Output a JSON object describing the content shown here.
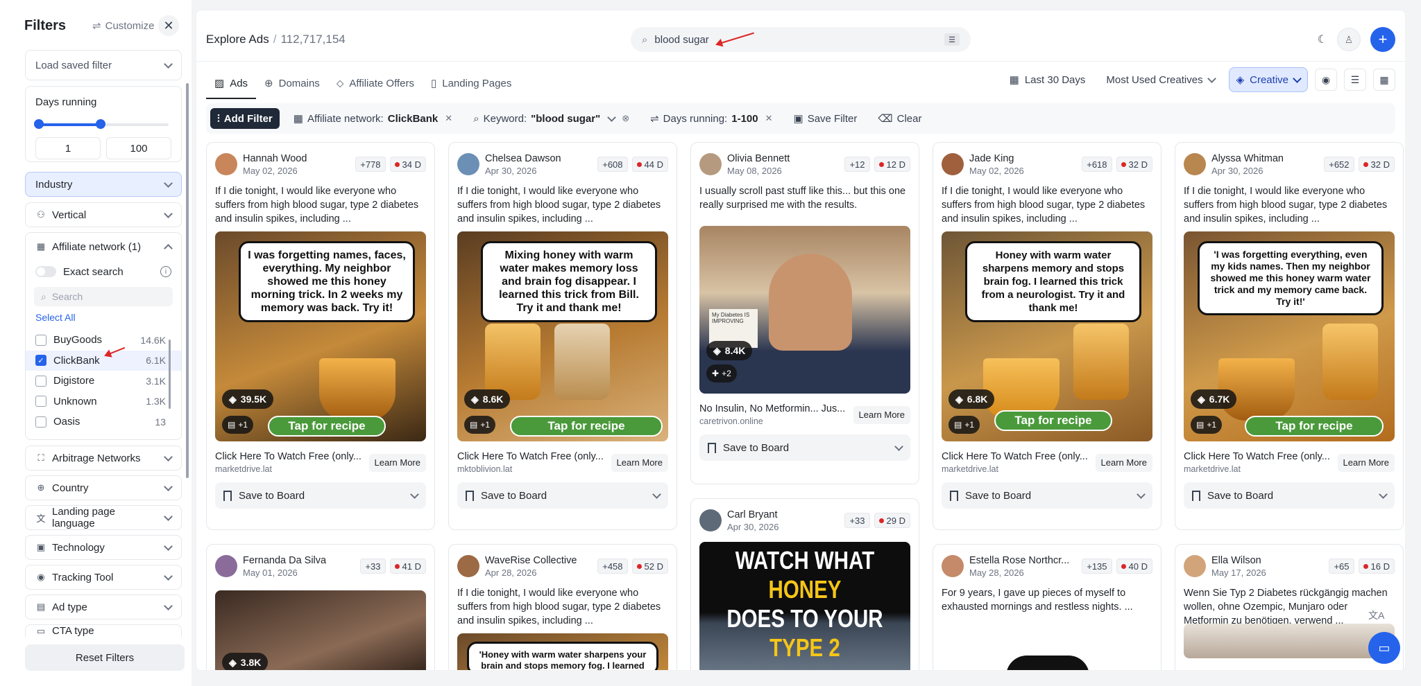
{
  "sidebar": {
    "title": "Filters",
    "customize": "Customize",
    "saved_filter_placeholder": "Load saved filter",
    "days_running": {
      "label": "Days running",
      "min": "1",
      "max": "100"
    },
    "sections": [
      "Industry",
      "Vertical"
    ],
    "affiliate": {
      "label": "Affiliate network (1)",
      "exact_search": "Exact search",
      "search_placeholder": "Search",
      "select_all": "Select All",
      "options": [
        {
          "name": "BuyGoods",
          "count": "14.6K",
          "checked": false
        },
        {
          "name": "ClickBank",
          "count": "6.1K",
          "checked": true
        },
        {
          "name": "Digistore",
          "count": "3.1K",
          "checked": false
        },
        {
          "name": "Unknown",
          "count": "1.3K",
          "checked": false
        },
        {
          "name": "Oasis",
          "count": "13",
          "checked": false
        }
      ]
    },
    "more_sections": [
      "Arbitrage Networks",
      "Country",
      "Landing page language",
      "Technology",
      "Tracking Tool",
      "Ad type",
      "CTA type"
    ],
    "reset": "Reset Filters"
  },
  "header": {
    "crumb": "Explore Ads",
    "count": "112,717,154",
    "search_value": "blood sugar"
  },
  "tabs": [
    "Ads",
    "Domains",
    "Affiliate Offers",
    "Landing Pages"
  ],
  "tools": {
    "range": "Last 30 Days",
    "sort": "Most Used Creatives",
    "view": "Creative"
  },
  "filters": {
    "add": "Add Filter",
    "chip1_label": "Affiliate network:",
    "chip1_value": "ClickBank",
    "chip2_label": "Keyword:",
    "chip2_value": "\"blood sugar\"",
    "chip3_label": "Days running:",
    "chip3_value": "1-100",
    "save": "Save Filter",
    "clear": "Clear"
  },
  "cards": [
    {
      "name": "Hannah Wood",
      "date": "May 02, 2026",
      "plus": "+778",
      "days": "34 D",
      "text": "If I die tonight, I would like everyone who suffers from high blood sugar, type 2 diabetes and insulin spikes, including ...",
      "bubble": "I was forgetting names, faces, everything. My neighbor showed me this honey morning trick. In 2 weeks my memory was back. Try it!",
      "views": "39.5K",
      "flag": "+1",
      "recipe": "Tap for recipe",
      "headline": "Click Here To Watch Free (only...",
      "domain": "marketdrive.lat",
      "cta": "Learn More",
      "save": "Save to Board"
    },
    {
      "name": "Chelsea Dawson",
      "date": "Apr 30, 2026",
      "plus": "+608",
      "days": "44 D",
      "text": "If I die tonight, I would like everyone who suffers from high blood sugar, type 2 diabetes and insulin spikes, including ...",
      "bubble": "Mixing honey with warm water makes memory loss and brain fog disappear. I learned this trick from Bill. Try it and thank me!",
      "views": "8.6K",
      "flag": "+1",
      "recipe": "Tap for recipe",
      "headline": "Click Here To Watch Free (only...",
      "domain": "mktoblivion.lat",
      "cta": "Learn More",
      "save": "Save to Board"
    },
    {
      "name": "Olivia Bennett",
      "date": "May 08, 2026",
      "plus": "+12",
      "days": "12 D",
      "text": "I usually scroll past stuff like this... but this one really surprised me with the results.",
      "views": "8.4K",
      "flag": "+2",
      "headline": "No Insulin, No Metformin... Jus...",
      "domain": "caretrivon.online",
      "cta": "Learn More",
      "save": "Save to Board",
      "note": "My Diabetes IS IMPROVING"
    },
    {
      "name": "Jade King",
      "date": "May 02, 2026",
      "plus": "+618",
      "days": "32 D",
      "text": "If I die tonight, I would like everyone who suffers from high blood sugar, type 2 diabetes and insulin spikes, including ...",
      "bubble": "Honey with warm water sharpens memory and stops brain fog. I learned this trick from a neurologist. Try it and thank me!",
      "views": "6.8K",
      "flag": "+1",
      "recipe": "Tap for recipe",
      "headline": "Click Here To Watch Free (only...",
      "domain": "marketdrive.lat",
      "cta": "Learn More",
      "save": "Save to Board"
    },
    {
      "name": "Alyssa Whitman",
      "date": "Apr 30, 2026",
      "plus": "+652",
      "days": "32 D",
      "text": "If I die tonight, I would like everyone who suffers from high blood sugar, type 2 diabetes and insulin spikes, including ...",
      "bubble": "'I was forgetting everything, even my kids names. Then my neighbor showed me this honey warm water trick and my memory came back. Try it!'",
      "views": "6.7K",
      "flag": "+1",
      "recipe": "Tap for recipe",
      "headline": "Click Here To Watch Free (only...",
      "domain": "marketdrive.lat",
      "cta": "Learn More",
      "save": "Save to Board"
    }
  ],
  "cards2": [
    {
      "name": "Fernanda Da Silva",
      "date": "May 01, 2026",
      "plus": "+33",
      "days": "41 D",
      "views": "3.8K"
    },
    {
      "name": "WaveRise Collective",
      "date": "Apr 28, 2026",
      "plus": "+458",
      "days": "52 D",
      "text": "If I die tonight, I would like everyone who suffers from high blood sugar, type 2 diabetes and insulin spikes, including ...",
      "bubble": "'Honey with warm water sharpens your brain and stops memory fog. I learned"
    },
    {
      "name": "Carl Bryant",
      "date": "Apr 30, 2026",
      "plus": "+33",
      "days": "29 D",
      "banner1": "WATCH WHAT ",
      "banner1b": "HONEY",
      "banner2": "DOES TO YOUR ",
      "banner2b": "TYPE 2"
    },
    {
      "name": "Estella Rose Northcr...",
      "date": "May 28, 2026",
      "plus": "+135",
      "days": "40 D",
      "text": "For 9 years, I gave up pieces of myself to exhausted mornings and restless nights. ..."
    },
    {
      "name": "Ella Wilson",
      "date": "May 17, 2026",
      "plus": "+65",
      "days": "16 D",
      "text": "Wenn Sie Typ 2 Diabetes rückgängig machen wollen, ohne Ozempic, Munjaro oder Metformin zu benötigen, verwend ..."
    }
  ]
}
